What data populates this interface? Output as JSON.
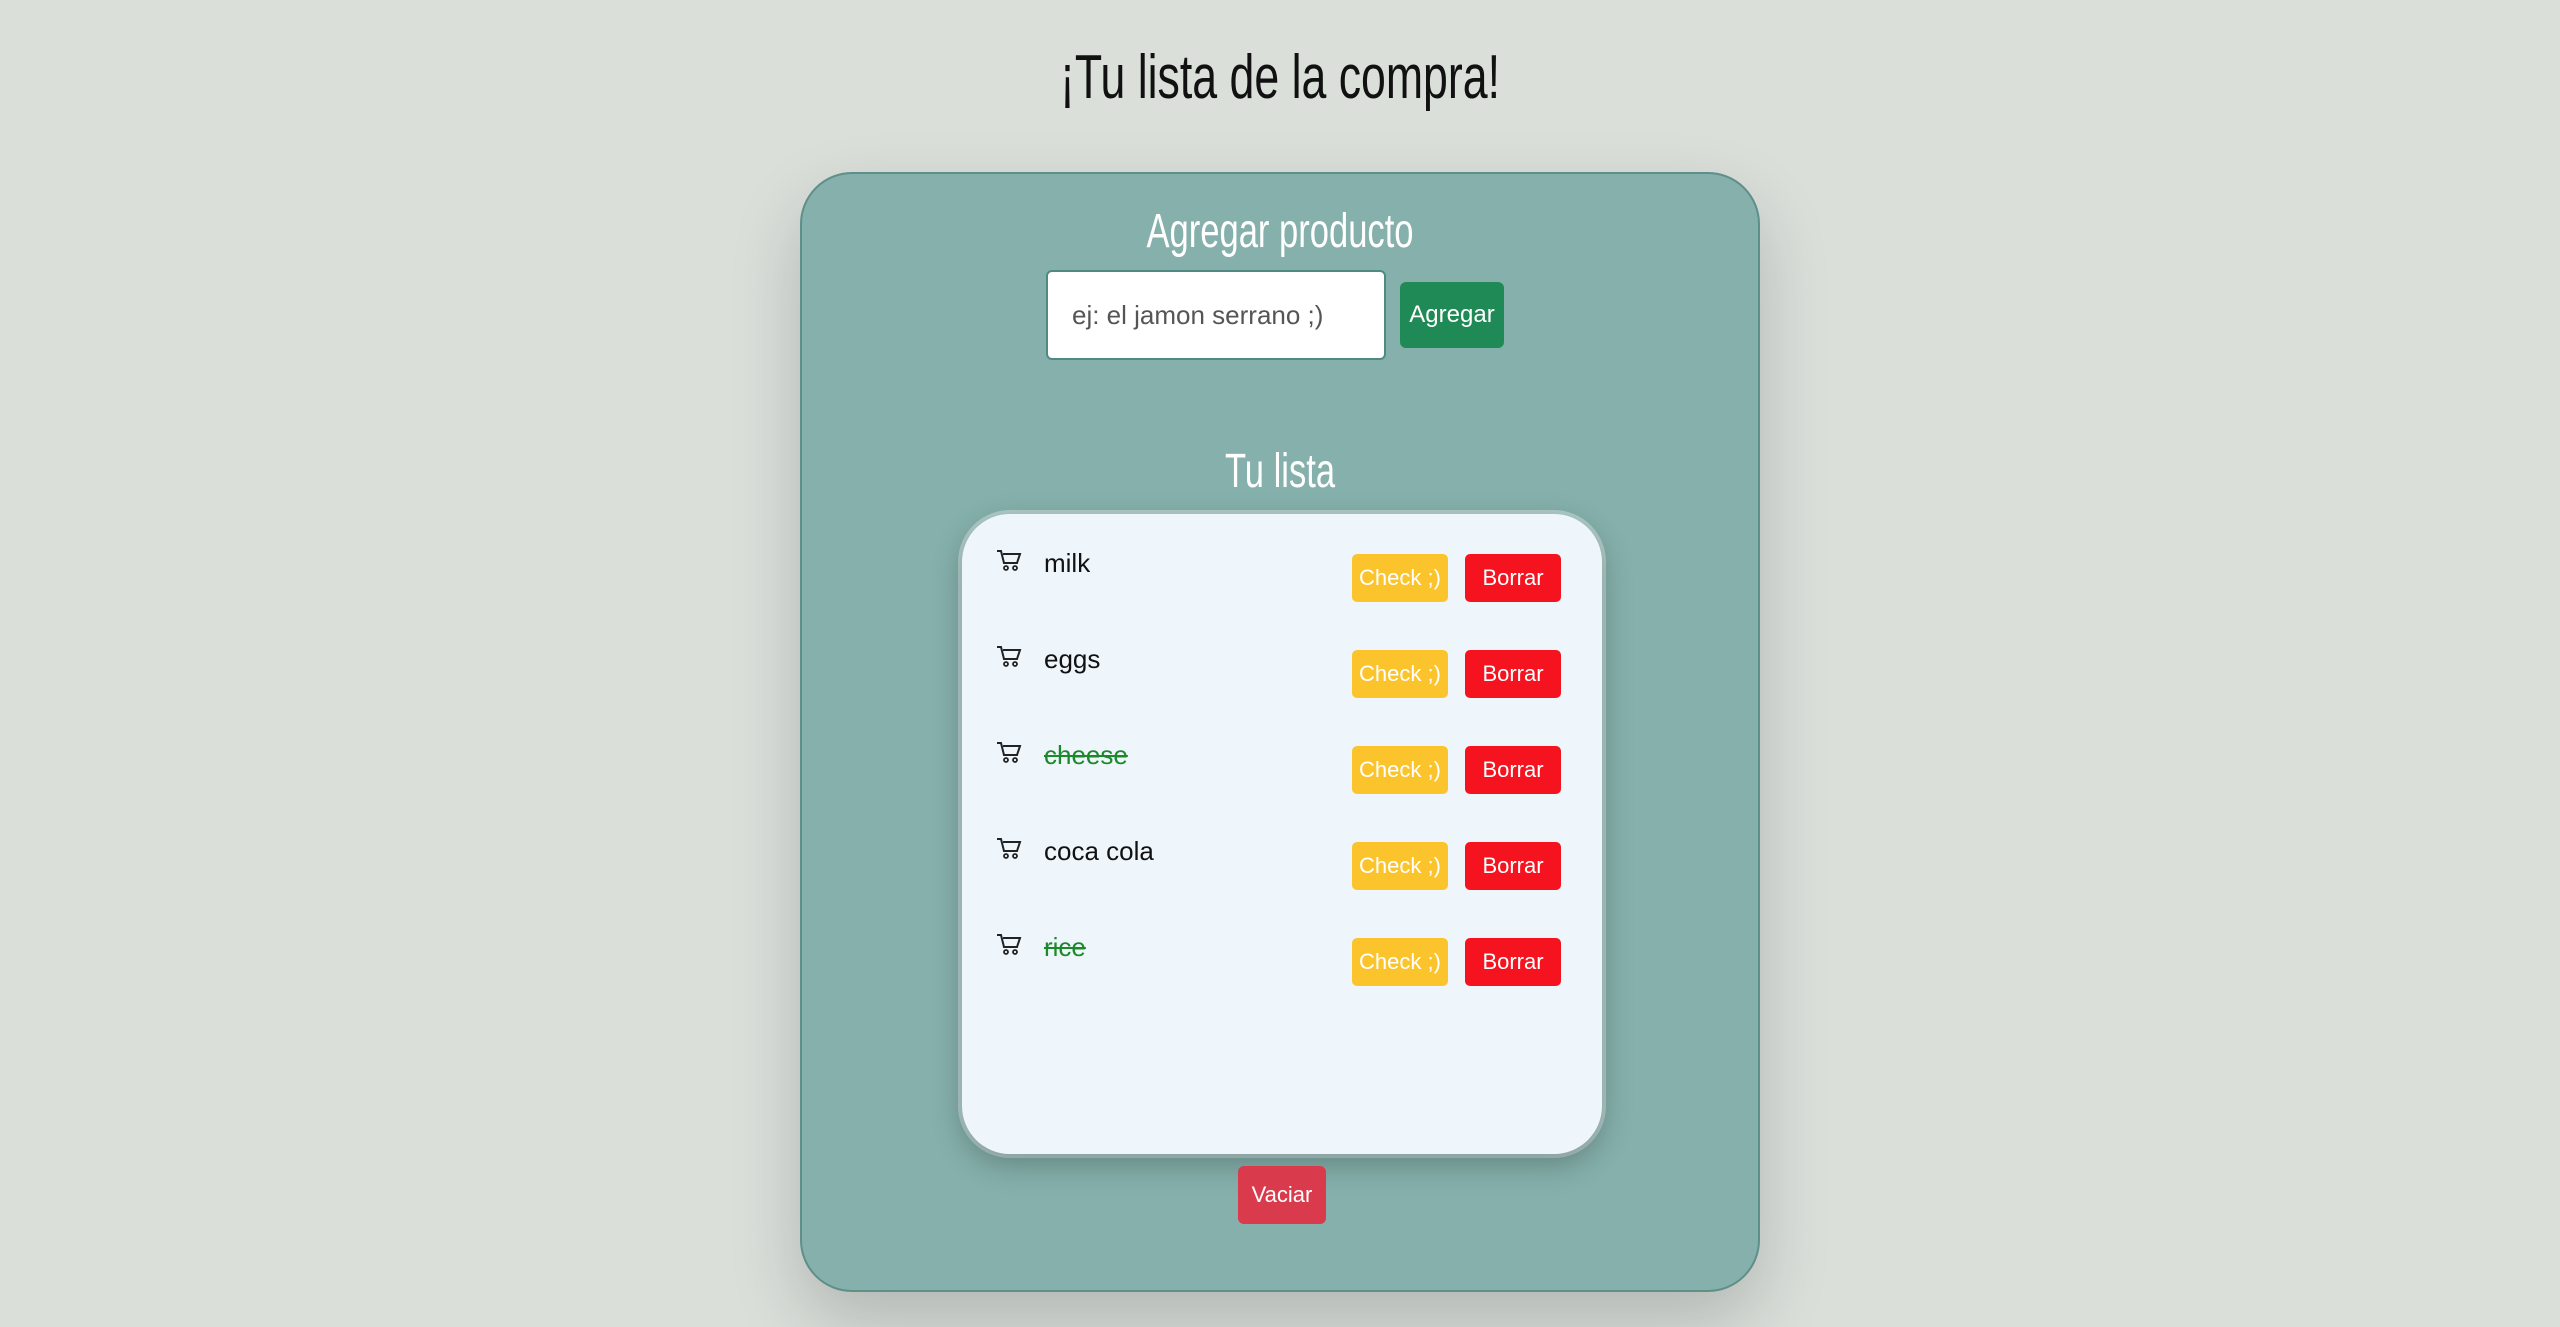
{
  "page": {
    "title": "¡Tu lista de la compra!"
  },
  "add_section": {
    "title": "Agregar producto",
    "input_placeholder": "ej: el jamon serrano ;)",
    "input_value": "",
    "add_button": "Agregar"
  },
  "list_section": {
    "title": "Tu lista",
    "items": [
      {
        "label": "milk",
        "checked": false,
        "check_label": "Check ;)",
        "delete_label": "Borrar"
      },
      {
        "label": "eggs",
        "checked": false,
        "check_label": "Check ;)",
        "delete_label": "Borrar"
      },
      {
        "label": "cheese",
        "checked": true,
        "check_label": "Check ;)",
        "delete_label": "Borrar"
      },
      {
        "label": "coca cola",
        "checked": false,
        "check_label": "Check ;)",
        "delete_label": "Borrar"
      },
      {
        "label": "rice",
        "checked": true,
        "check_label": "Check ;)",
        "delete_label": "Borrar"
      }
    ],
    "clear_button": "Vaciar"
  },
  "icons": {
    "item_icon": "cart-icon"
  },
  "colors": {
    "background": "#dadfda",
    "card": "#85b0ab",
    "add_button": "#1f8a55",
    "check_button": "#fcc42c",
    "delete_button": "#f4131f",
    "clear_button": "#d93a4c",
    "checked_text": "#1c8a2a"
  }
}
